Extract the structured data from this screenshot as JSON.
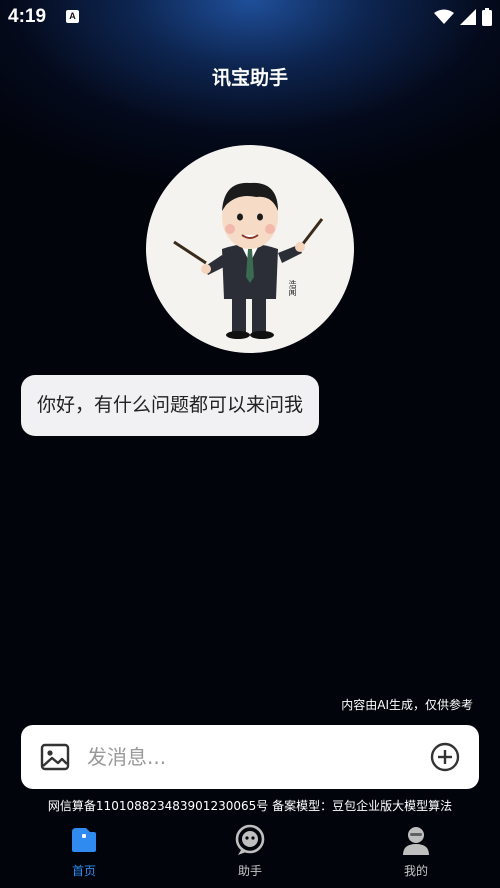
{
  "status_bar": {
    "time": "4:19",
    "app_icon_letter": "A",
    "icons": [
      "wifi-icon",
      "signal-icon",
      "battery-icon"
    ]
  },
  "header": {
    "title": "讯宝助手"
  },
  "avatar": {
    "signature_text": "浩闻"
  },
  "chat": {
    "messages": [
      {
        "from": "assistant",
        "text": "你好，有什么问题都可以来问我"
      }
    ]
  },
  "disclaimer": "内容由AI生成，仅供参考",
  "input": {
    "placeholder": "发消息...",
    "value": ""
  },
  "filing": "网信算备110108823483901230065号 备案模型：豆包企业版大模型算法",
  "tabs": [
    {
      "label": "首页",
      "icon": "home-icon",
      "active": true
    },
    {
      "label": "助手",
      "icon": "assistant-bot-icon",
      "active": false
    },
    {
      "label": "我的",
      "icon": "profile-icon",
      "active": false
    }
  ],
  "colors": {
    "accent": "#2f8bf0",
    "background": "#02040c",
    "bubble": "#f1f1f3"
  }
}
